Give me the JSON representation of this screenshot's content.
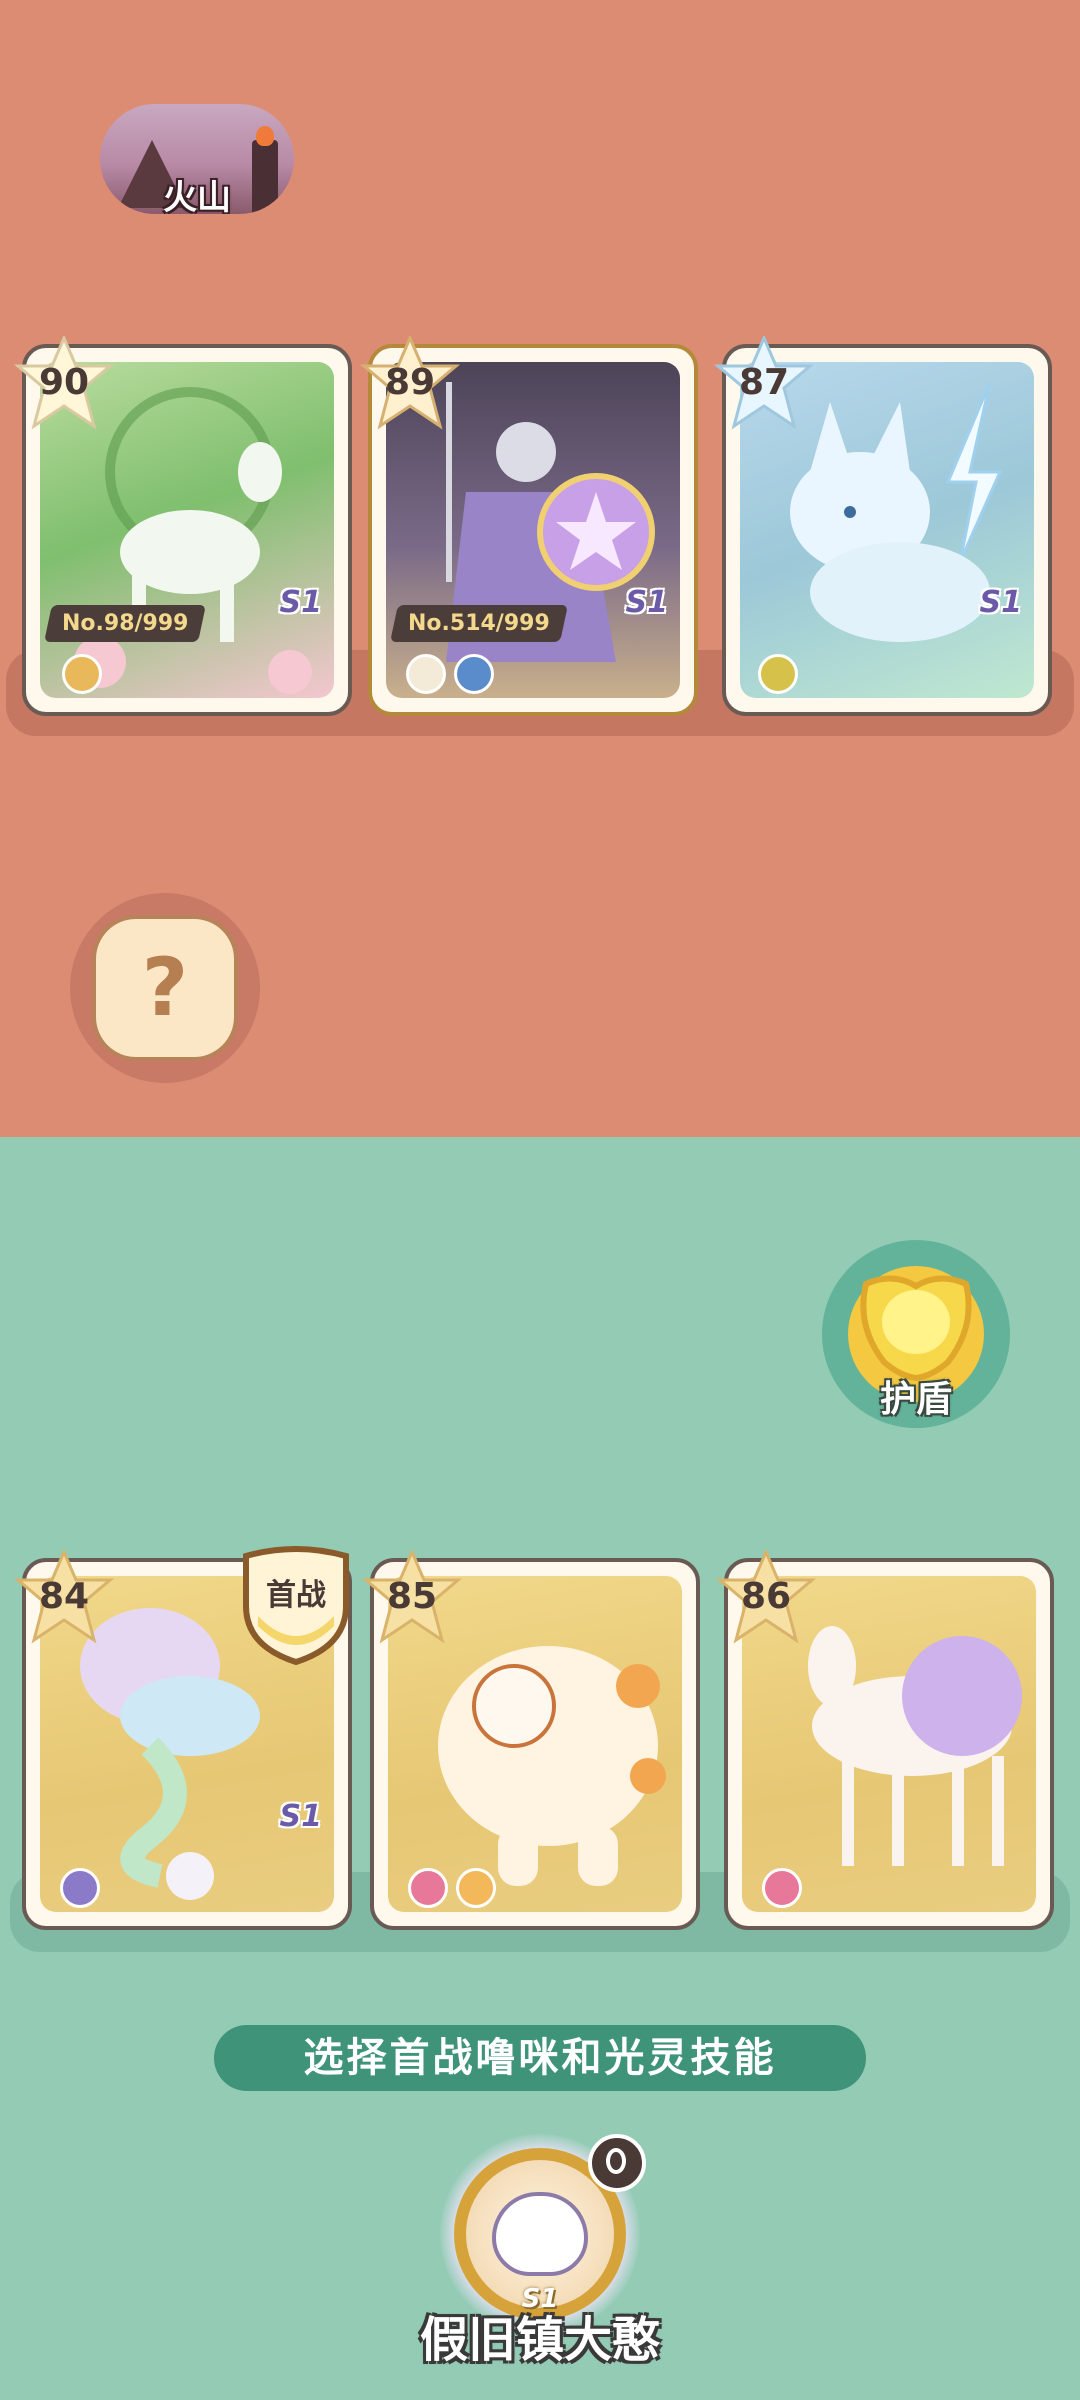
{
  "location": {
    "name": "火山",
    "icon": "volcano-icon"
  },
  "enemy_cards": [
    {
      "rating": "90",
      "serial": "No.98/999",
      "season": "S1",
      "theme": "#8fc47c",
      "creature": "deer-spirit"
    },
    {
      "rating": "89",
      "serial": "No.514/999",
      "season": "S1",
      "theme": "#7a6a88",
      "creature": "knight-spirit"
    },
    {
      "rating": "87",
      "serial": "",
      "season": "S1",
      "theme": "#9cc8d8",
      "creature": "ice-wolf"
    }
  ],
  "help_button": {
    "symbol": "?"
  },
  "shield_button": {
    "label": "护盾",
    "icon": "shield-icon"
  },
  "my_cards": [
    {
      "rating": "84",
      "season": "S1",
      "first_badge": "首战",
      "creature": "genie-elephant"
    },
    {
      "rating": "85",
      "season": "",
      "first_badge": "",
      "creature": "lucky-cat-brute"
    },
    {
      "rating": "86",
      "season": "",
      "first_badge": "",
      "creature": "unicorn"
    }
  ],
  "prompt": {
    "text": "选择首战噜咪和光灵技能"
  },
  "player": {
    "name": "假旧镇大憨",
    "season": "S1"
  },
  "colors": {
    "enemy_bg": "#dd8c74",
    "player_bg": "#93cbb5",
    "prompt_bg": "#3e9379"
  }
}
